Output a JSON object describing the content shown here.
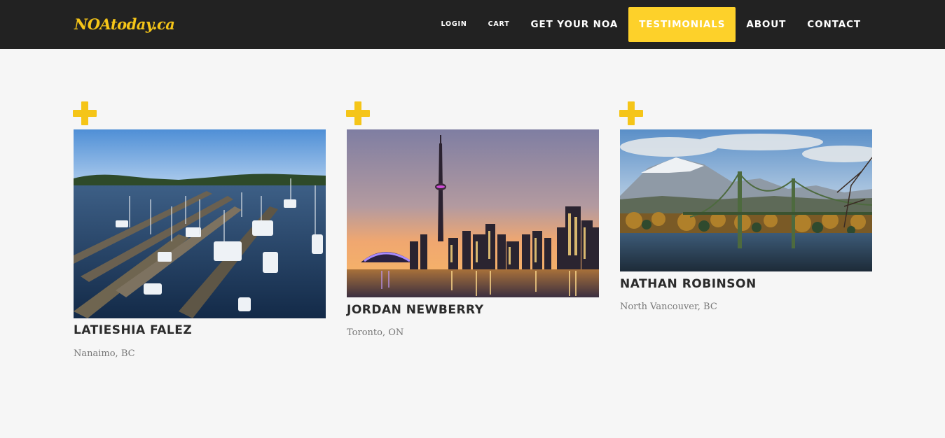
{
  "header": {
    "logo": "NOAtoday.ca",
    "nav": [
      {
        "label": "LOGIN"
      },
      {
        "label": "CART"
      },
      {
        "label": "GET YOUR NOA"
      },
      {
        "label": "TESTIMONIALS",
        "active": true
      },
      {
        "label": "ABOUT"
      },
      {
        "label": "CONTACT"
      }
    ]
  },
  "testimonials": [
    {
      "name": "LATIESHIA FALEZ",
      "location": "Nanaimo, BC",
      "photo": "marina-harbour-photo"
    },
    {
      "name": "JORDAN NEWBERRY",
      "location": "Toronto, ON",
      "photo": "toronto-skyline-photo"
    },
    {
      "name": "NATHAN ROBINSON",
      "location": "North Vancouver, BC",
      "photo": "lions-gate-bridge-photo"
    }
  ],
  "colors": {
    "accent": "#fdd12a",
    "navbar_bg": "#222222",
    "page_bg": "#f6f6f6",
    "name_text": "#2b2b2b",
    "location_text": "#777777"
  },
  "icons": {
    "card_marker": "plus-icon"
  }
}
